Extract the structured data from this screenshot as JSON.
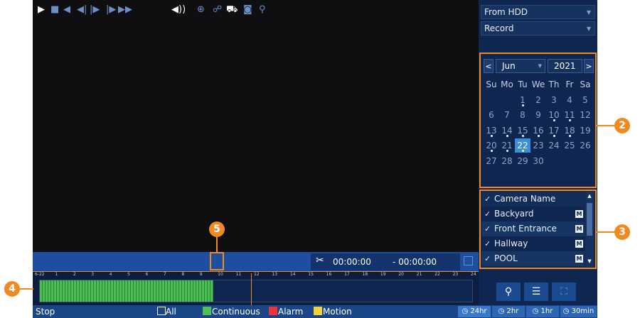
{
  "source_select": {
    "value": "From HDD"
  },
  "type_select": {
    "value": "Record"
  },
  "calendar": {
    "prev": "<",
    "next": ">",
    "month": "Jun",
    "year": "2021",
    "weekdays": [
      "Su",
      "Mo",
      "Tu",
      "We",
      "Th",
      "Fr",
      "Sa"
    ],
    "selected_day": "22",
    "days_with_records": [
      "1",
      "10",
      "11",
      "13",
      "14",
      "15",
      "16",
      "17",
      "18",
      "20",
      "21",
      "22"
    ],
    "weeks": [
      [
        "",
        "",
        "1",
        "2",
        "3",
        "4",
        "5"
      ],
      [
        "6",
        "7",
        "8",
        "9",
        "10",
        "11",
        "12"
      ],
      [
        "13",
        "14",
        "15",
        "16",
        "17",
        "18",
        "19"
      ],
      [
        "20",
        "21",
        "22",
        "23",
        "24",
        "25",
        "26"
      ],
      [
        "27",
        "28",
        "29",
        "30",
        "",
        "",
        ""
      ]
    ]
  },
  "cameras": {
    "header": "Camera Name",
    "items": [
      {
        "name": "Backyard",
        "badge": "M"
      },
      {
        "name": "Front Entrance",
        "badge": "M"
      },
      {
        "name": "Hallway",
        "badge": "M"
      },
      {
        "name": "POOL",
        "badge": "M"
      }
    ]
  },
  "controls": {
    "start_time": "00:00:00",
    "end_time": "- 00:00:00"
  },
  "timeline": {
    "start_label": "6-22",
    "hours": [
      "1",
      "2",
      "3",
      "4",
      "5",
      "6",
      "7",
      "8",
      "9",
      "10",
      "11",
      "12",
      "13",
      "14",
      "15",
      "16",
      "17",
      "18",
      "19",
      "20",
      "21",
      "22",
      "23",
      "24"
    ]
  },
  "status_bar": {
    "state": "Stop",
    "all": "All",
    "continuous": "Continuous",
    "alarm": "Alarm",
    "motion": "Motion",
    "zoom": [
      "24hr",
      "2hr",
      "1hr",
      "30min"
    ]
  },
  "callouts": {
    "two": "2",
    "three": "3",
    "four": "4",
    "five": "5"
  },
  "colors": {
    "continuous": "#4cbf55",
    "alarm": "#e8343a",
    "motion": "#f2d23a",
    "callout": "#f08a20",
    "panel": "#0f2750"
  }
}
